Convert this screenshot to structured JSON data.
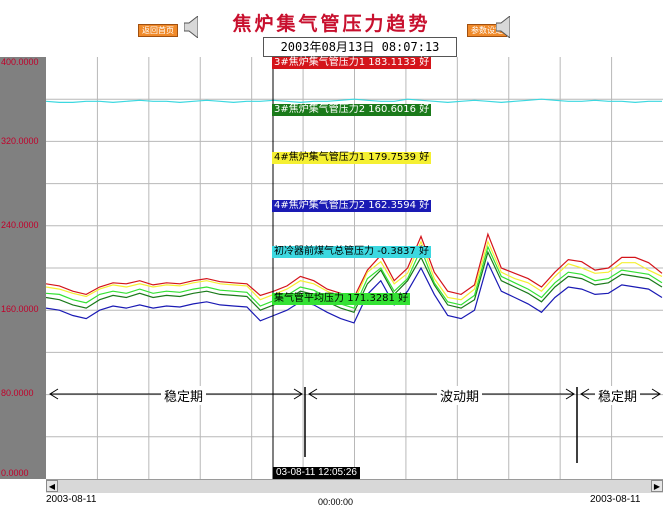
{
  "header": {
    "title": "焦炉集气管压力趋势",
    "left_button": "返回首页",
    "right_button": "参数设定",
    "datetime": "2003年08月13日  08:07:13"
  },
  "chart_data": {
    "type": "line",
    "ylim": [
      0,
      400
    ],
    "y_ticks": [
      "400.0000",
      "320.0000",
      "240.0000",
      "160.0000",
      "80.0000",
      "0.0000"
    ],
    "x_start_label": "2003-08-11",
    "x_end_label": "2003-08-11",
    "x_mid_label": "00:00:00",
    "grid": true,
    "cursor_time": "03-08-11 12:05:26",
    "series": [
      {
        "name": "3#焦炉集气管压力1",
        "value": "183.1133",
        "unit": "好",
        "color": "#d4141a",
        "text_color": "#ffffff",
        "values": [
          185,
          183,
          178,
          175,
          182,
          186,
          185,
          188,
          184,
          186,
          185,
          188,
          190,
          187,
          186,
          185,
          174,
          178,
          183,
          192,
          188,
          180,
          176,
          172,
          198,
          212,
          188,
          200,
          230,
          196,
          178,
          175,
          184,
          232,
          200,
          195,
          190,
          182,
          196,
          208,
          206,
          198,
          200,
          210,
          210,
          205,
          195
        ]
      },
      {
        "name": "3#焦炉集气管压力2",
        "value": "160.6016",
        "unit": "好",
        "color": "#1a7a1a",
        "text_color": "#ffffff",
        "values": [
          172,
          170,
          165,
          162,
          170,
          174,
          172,
          176,
          172,
          174,
          173,
          176,
          178,
          175,
          174,
          173,
          160,
          165,
          170,
          178,
          175,
          168,
          162,
          158,
          185,
          198,
          175,
          188,
          210,
          184,
          165,
          162,
          170,
          215,
          188,
          182,
          176,
          168,
          182,
          192,
          190,
          184,
          186,
          194,
          192,
          190,
          182
        ]
      },
      {
        "name": "4#焦炉集气管压力1",
        "value": "179.7539",
        "unit": "好",
        "color": "#f5f032",
        "text_color": "#000000",
        "values": [
          182,
          180,
          176,
          173,
          180,
          184,
          182,
          185,
          182,
          184,
          183,
          186,
          188,
          185,
          184,
          183,
          170,
          175,
          180,
          188,
          185,
          178,
          172,
          168,
          196,
          206,
          185,
          195,
          225,
          190,
          172,
          170,
          180,
          225,
          196,
          190,
          186,
          178,
          192,
          204,
          200,
          195,
          196,
          205,
          205,
          198,
          192
        ]
      },
      {
        "name": "4#焦炉集气管压力2",
        "value": "162.3594",
        "unit": "好",
        "color": "#1a1ab4",
        "text_color": "#ffffff",
        "values": [
          162,
          160,
          155,
          152,
          160,
          164,
          162,
          165,
          162,
          164,
          163,
          166,
          168,
          165,
          164,
          163,
          150,
          155,
          160,
          168,
          165,
          158,
          152,
          148,
          175,
          188,
          165,
          178,
          200,
          175,
          155,
          152,
          160,
          205,
          178,
          172,
          166,
          158,
          172,
          182,
          180,
          175,
          176,
          184,
          182,
          180,
          172
        ]
      },
      {
        "name": "初冷器前煤气总管压力",
        "value": "-0.3837",
        "unit": "好",
        "color": "#3cd8e0",
        "text_color": "#000000",
        "values": [
          358,
          357,
          357,
          358,
          358,
          357,
          358,
          359,
          358,
          358,
          357,
          358,
          359,
          358,
          357,
          358,
          358,
          359,
          358,
          357,
          358,
          358,
          359,
          360,
          359,
          358,
          358,
          360,
          359,
          358,
          357,
          358,
          359,
          358,
          357,
          358,
          359,
          360,
          359,
          358,
          358,
          359,
          358,
          358,
          357,
          358,
          358
        ]
      },
      {
        "name": "集气管平均压力",
        "value": "171.3281",
        "unit": "好",
        "color": "#34e234",
        "text_color": "#000000",
        "values": [
          176,
          175,
          170,
          167,
          175,
          178,
          176,
          180,
          176,
          178,
          177,
          180,
          182,
          179,
          178,
          177,
          164,
          169,
          174,
          182,
          179,
          172,
          166,
          162,
          190,
          200,
          178,
          190,
          218,
          186,
          168,
          165,
          174,
          220,
          192,
          186,
          180,
          172,
          186,
          196,
          194,
          188,
          190,
          198,
          196,
          194,
          186
        ]
      }
    ]
  },
  "annotations": {
    "stable1": "稳定期",
    "fluct": "波动期",
    "stable2": "稳定期"
  }
}
